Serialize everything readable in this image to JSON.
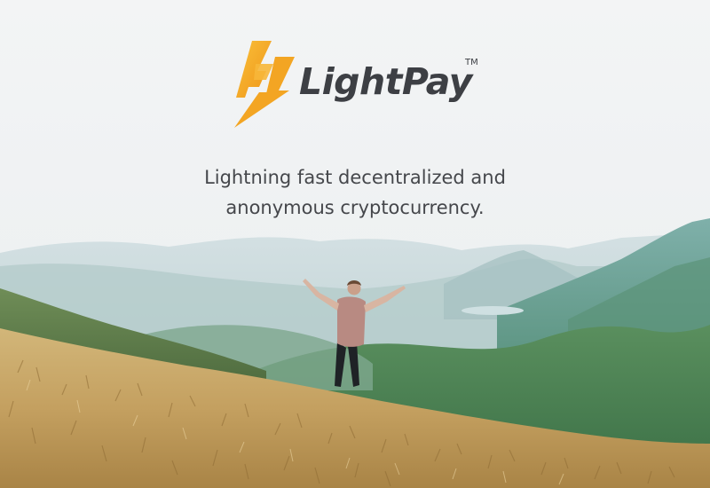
{
  "brand": {
    "name": "LightPay",
    "trademark": "TM",
    "colors": {
      "bolt_light": "#f7b32b",
      "bolt_dark": "#f19a1c",
      "text": "#3d3f44"
    }
  },
  "tagline": {
    "line1": "Lightning fast decentralized and",
    "line2": "anonymous cryptocurrency."
  },
  "scene": {
    "subject": "person with arms raised on a grassy hillside overlooking misty mountains",
    "sky_color": "#f1f3f4",
    "mountain_color": "#5f9a92",
    "grass_color": "#c9a76a"
  }
}
